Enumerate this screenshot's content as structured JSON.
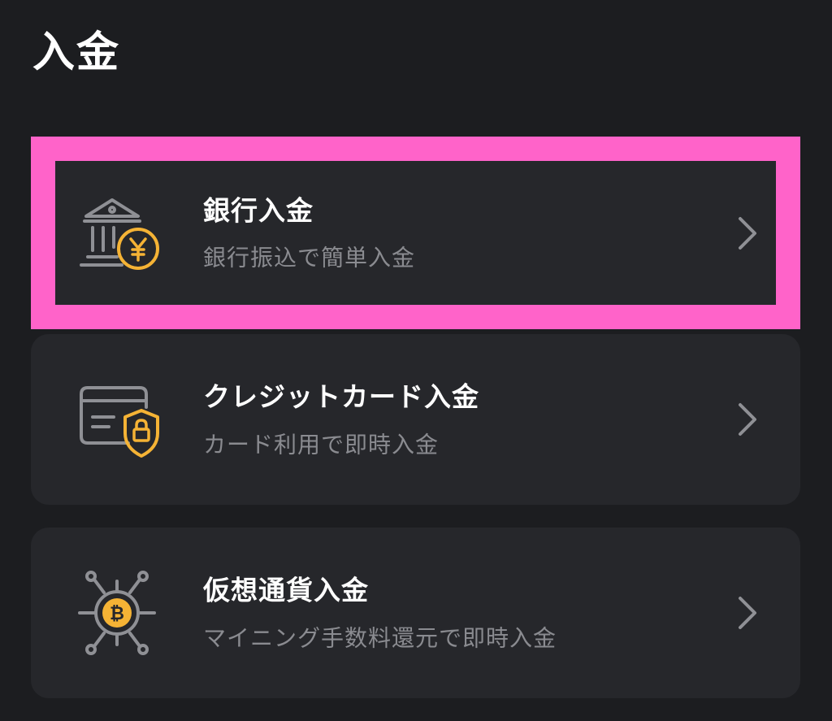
{
  "header": {
    "title": "入金"
  },
  "options": [
    {
      "title": "銀行入金",
      "subtitle": "銀行振込で簡単入金",
      "icon": "bank-yen-icon",
      "highlighted": true
    },
    {
      "title": "クレジットカード入金",
      "subtitle": "カード利用で即時入金",
      "icon": "credit-card-lock-icon",
      "highlighted": false
    },
    {
      "title": "仮想通貨入金",
      "subtitle": "マイニング手数料還元で即時入金",
      "icon": "bitcoin-network-icon",
      "highlighted": false
    }
  ],
  "colors": {
    "background": "#1c1d20",
    "card": "#26272b",
    "highlight": "#ff63c9",
    "accent": "#f5b335",
    "icon_gray": "#8f9095",
    "subtitle": "#8a8b90"
  }
}
